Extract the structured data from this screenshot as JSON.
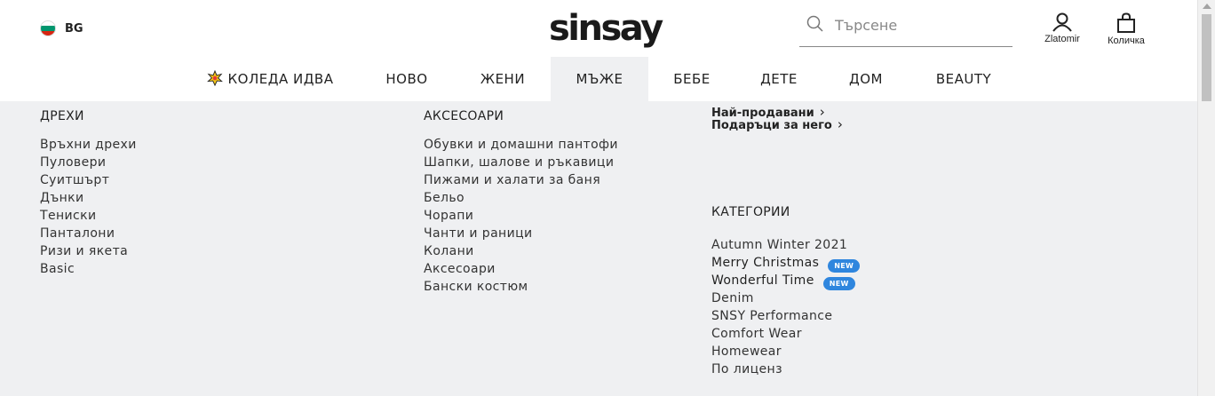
{
  "header": {
    "language": "BG",
    "flag_colors": [
      "#ffffff",
      "#00966e",
      "#d62612"
    ],
    "logo": "sinsay",
    "search_placeholder": "Търсене",
    "account_label": "Zlatomir",
    "cart_label": "Количка",
    "icons": [
      "bulgaria-flag-icon",
      "search-icon",
      "user-icon",
      "shopping-bag-icon",
      "christmas-star-icon",
      "chevron-right-icon"
    ]
  },
  "nav": {
    "items": [
      {
        "label": "КОЛЕДА ИДВА"
      },
      {
        "label": "НОВО"
      },
      {
        "label": "ЖЕНИ"
      },
      {
        "label": "МЪЖЕ"
      },
      {
        "label": "БЕБЕ"
      },
      {
        "label": "ДЕТЕ"
      },
      {
        "label": "ДОМ"
      },
      {
        "label": "BEAUTY"
      }
    ],
    "active": "МЪЖЕ"
  },
  "menu": {
    "clothes": {
      "title": "ДРЕХИ",
      "links": [
        "Връхни дрехи",
        "Пуловери",
        "Суитшърт",
        "Дънки",
        "Тениски",
        "Панталони",
        "Ризи и якета",
        "Basic"
      ]
    },
    "accessories": {
      "title": "АКСЕСОАРИ",
      "links": [
        "Обувки и домашни пантофи",
        "Шапки, шалове и ръкавици",
        "Пижами и халати за баня",
        "Бельо",
        "Чорапи",
        "Чанти и раници",
        "Колани",
        "Аксесоари",
        "Бански костюм"
      ]
    },
    "promos": [
      "Най-продавани",
      "Подаръци за него"
    ],
    "categories": {
      "title": "КАТЕГОРИИ",
      "links": [
        {
          "label": "Autumn Winter 2021",
          "badge": ""
        },
        {
          "label": "Merry Christmas",
          "badge": "NEW"
        },
        {
          "label": "Wonderful Time",
          "badge": "NEW"
        },
        {
          "label": "Denim",
          "badge": ""
        },
        {
          "label": "SNSY Performance",
          "badge": ""
        },
        {
          "label": "Comfort Wear",
          "badge": ""
        },
        {
          "label": "Homewear",
          "badge": ""
        },
        {
          "label": "По лиценз",
          "badge": ""
        }
      ]
    }
  },
  "colors": {
    "menu_background": "#eff0f2",
    "badge": "#2f86de"
  }
}
